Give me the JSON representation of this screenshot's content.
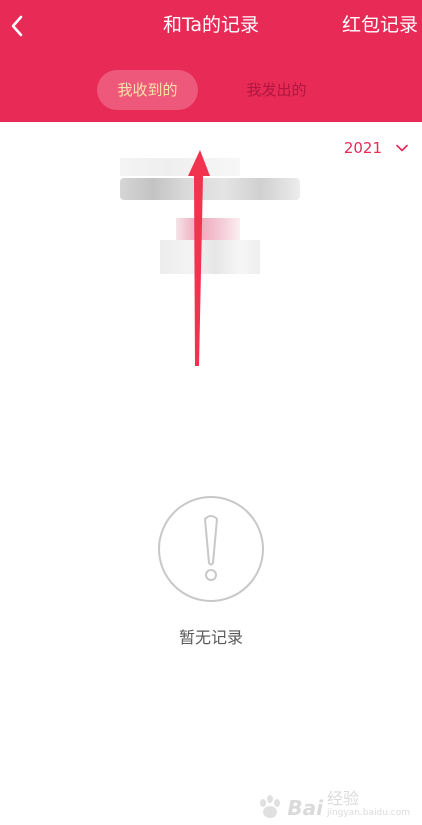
{
  "header": {
    "title": "和Ta的记录",
    "action_label": "红包记录",
    "background_color": "#e82a57",
    "back_icon": "chevron-left-icon"
  },
  "tabs": [
    {
      "label": "我收到的",
      "active": true
    },
    {
      "label": "我发出的",
      "active": false
    }
  ],
  "year_filter": {
    "value": "2021",
    "icon": "chevron-down-icon"
  },
  "empty_state": {
    "icon": "exclamation-circle-icon",
    "message": "暂无记录"
  },
  "annotation": {
    "type": "red-arrow",
    "color": "#f2334f"
  },
  "watermark": {
    "brand": "Bai",
    "cn_text": "经验",
    "url": "jingyan.baidu.com"
  }
}
